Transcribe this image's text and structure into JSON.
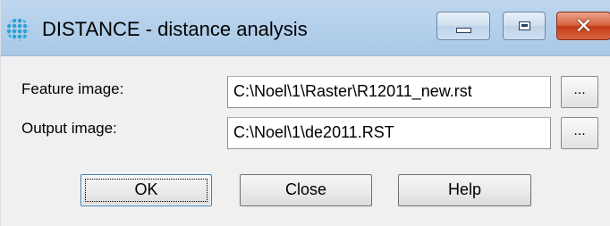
{
  "window": {
    "title": "DISTANCE - distance analysis",
    "icon": "idrisi-dot-matrix-icon",
    "controls": {
      "minimize_icon": "minimize-icon",
      "maximize_icon": "maximize-icon",
      "close_glyph": "✕"
    }
  },
  "form": {
    "feature_label": "Feature image:",
    "feature_value": "C:\\Noel\\1\\Raster\\R12011_new.rst",
    "output_label": "Output image:",
    "output_value": "C:\\Noel\\1\\de2011.RST",
    "browse_label": "..."
  },
  "buttons": {
    "ok": "OK",
    "close": "Close",
    "help": "Help"
  }
}
